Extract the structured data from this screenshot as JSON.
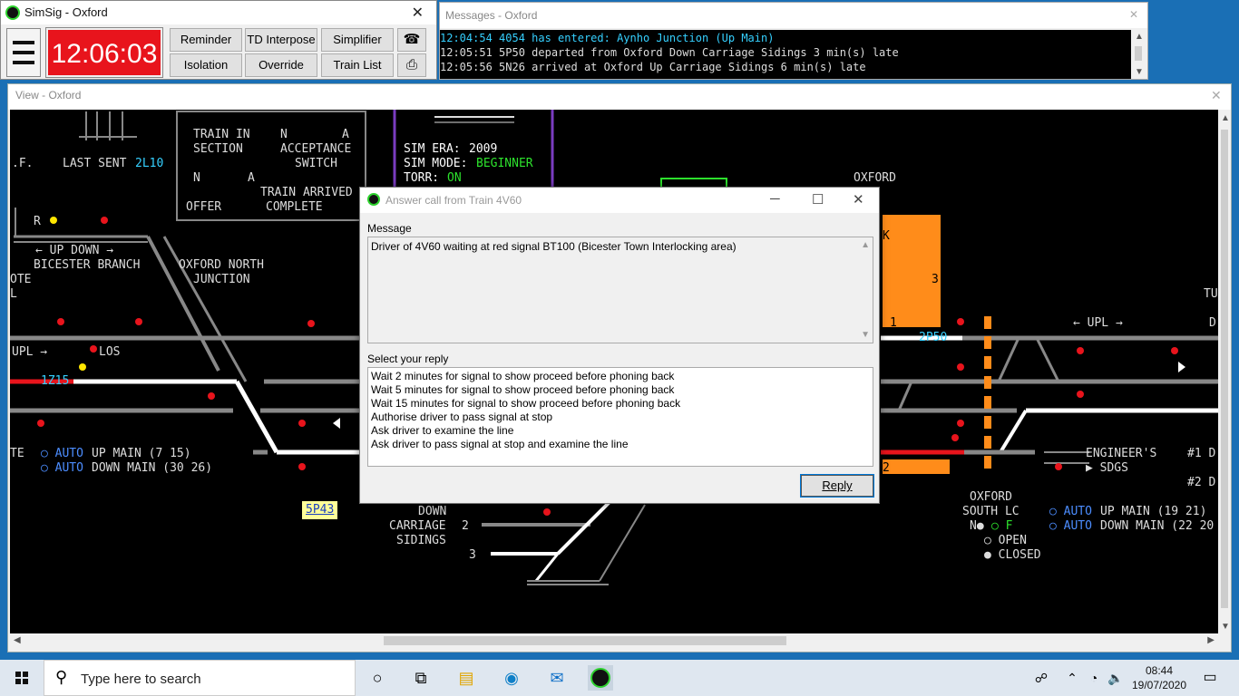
{
  "main_window": {
    "title": "SimSig - Oxford",
    "clock": "12:06:03",
    "buttons": [
      "Reminder",
      "TD Interpose",
      "Simplifier",
      "Isolation",
      "Override",
      "Train List"
    ],
    "phone_icon": "phone-icon",
    "print_icon": "printer-icon"
  },
  "messages_window": {
    "title": "Messages - Oxford",
    "lines": [
      "12:04:54 4054 has entered: Aynho Junction (Up Main)",
      "12:05:51 5P50 departed from Oxford Down Carriage Sidings 3 min(s) late",
      "12:05:56 5N26 arrived at Oxford Up Carriage Sidings 6 min(s) late"
    ]
  },
  "view_window": {
    "title": "View - Oxford",
    "labels": {
      "train_in_section": "TRAIN IN",
      "section": "SECTION",
      "acceptance": "ACCEPTANCE",
      "switch": "SWITCH",
      "n_a": "N",
      "a": "A",
      "train_arrived": "TRAIN ARRIVED",
      "offer": "OFFER",
      "complete": "COMPLETE",
      "last_sent": "LAST SENT",
      "last_sent_value": "2L10",
      "ef": ".F.",
      "sim_era_label": "SIM ERA:",
      "sim_era_value": "2009",
      "sim_mode_label": "SIM MODE:",
      "sim_mode_value": "BEGINNER",
      "torr_label": "TORR:",
      "torr_value": "ON",
      "oxford": "OXFORD",
      "up_down": "← UP   DOWN →",
      "bicester_branch": "BICESTER BRANCH",
      "oxford_north": "OXFORD NORTH",
      "junction": "JUNCTION",
      "ote": "OTE",
      "l": "L",
      "r": "R",
      "upl": "UPL →",
      "los": "LOS",
      "train_1z15": "1Z15",
      "te": "TE",
      "auto": "AUTO",
      "up_main_1": "UP MAIN (7 15)",
      "down_main_1": "DOWN MAIN (30 26)",
      "tag_5p43": "5P43",
      "down": "DOWN",
      "carriage": "CARRIAGE",
      "sidings": "SIDINGS",
      "n2": "2",
      "n3": "3",
      "upl_right": "← UPL →",
      "train_2p50": "2P50",
      "n1": "1",
      "n3b": "3",
      "n2b": "2",
      "k": "K",
      "tu": "TU",
      "d": "D",
      "engineers": "ENGINEER'S",
      "sdgs": "SDGS",
      "h1d": "#1 D",
      "h2d": "#2 D",
      "oxford_south": "OXFORD",
      "south_lc": "SOUTH LC",
      "n_f_n": "N",
      "n_f_f": "F",
      "open": "OPEN",
      "closed": "CLOSED",
      "up_main_2": "UP MAIN (19 21)",
      "down_main_2": "DOWN MAIN (22 20"
    }
  },
  "dialog": {
    "title": "Answer call from Train 4V60",
    "message_label": "Message",
    "message": "Driver of 4V60 waiting at red signal BT100 (Bicester Town Interlocking area)",
    "reply_label": "Select your reply",
    "options": [
      "Wait 2 minutes for signal to show proceed before phoning back",
      "Wait 5 minutes for signal to show proceed before phoning back",
      "Wait 15 minutes for signal to show proceed before phoning back",
      "Authorise driver to pass signal at stop",
      "Ask driver to examine the line",
      "Ask driver to pass signal at stop and examine the line"
    ],
    "reply_button": "Reply"
  },
  "taskbar": {
    "search_placeholder": "Type here to search",
    "time": "08:44",
    "date": "19/07/2020"
  },
  "colors": {
    "clock_bg": "#e8141c",
    "track": "#888888",
    "route_set": "#ffffff",
    "occupied": "#e8141c",
    "highlight": "#ff8c1a",
    "train_id": "#35d0ff",
    "status_on": "#2de22d"
  }
}
